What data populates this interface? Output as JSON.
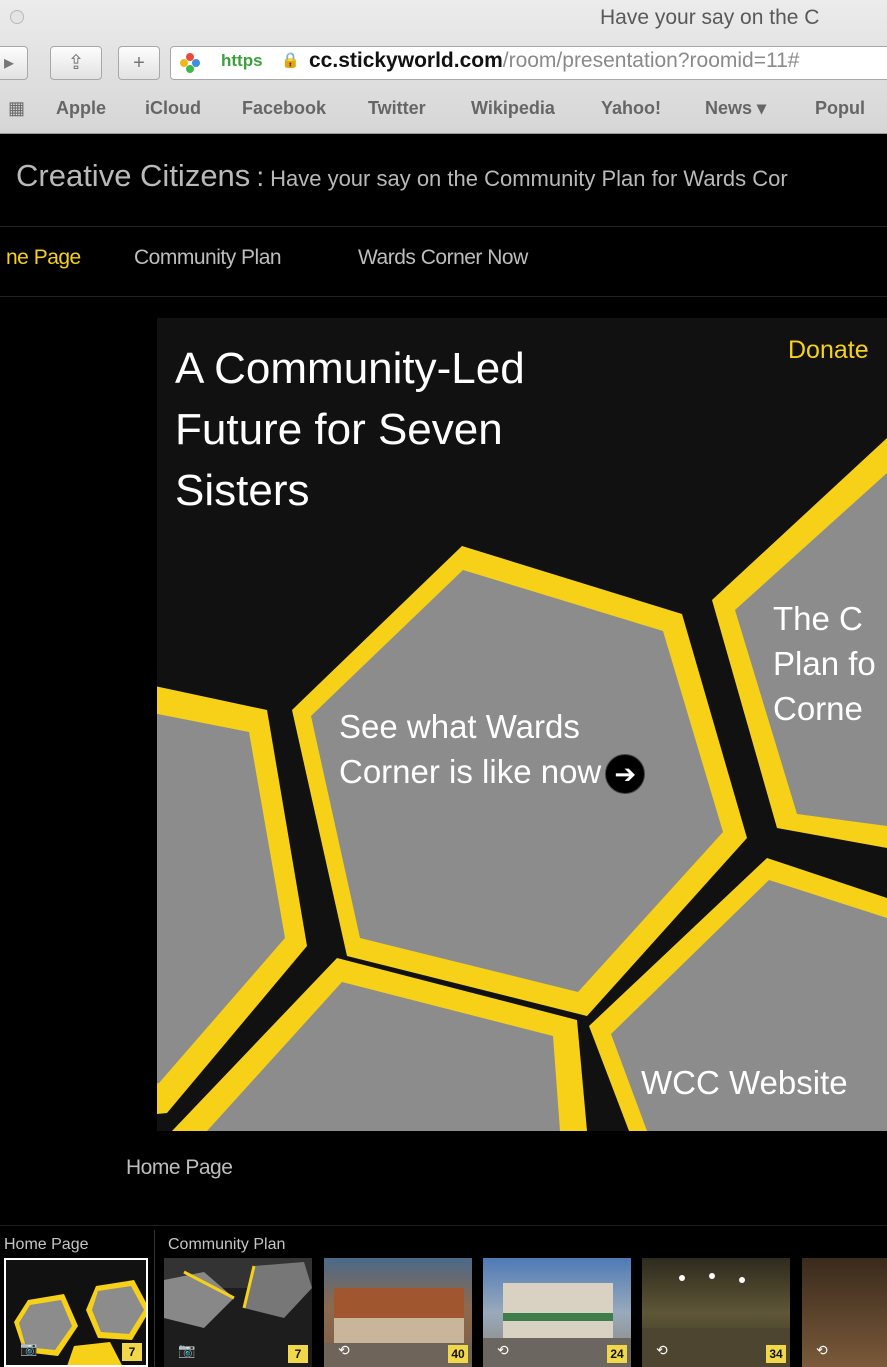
{
  "browser": {
    "window_title": "Have your say on the C",
    "url_scheme": "https",
    "url_host": "cc.stickyworld.com",
    "url_path": "/room/presentation?roomid=11#",
    "bookmarks": [
      "Apple",
      "iCloud",
      "Facebook",
      "Twitter",
      "Wikipedia",
      "Yahoo!",
      "News ▾",
      "Popul"
    ]
  },
  "site": {
    "name": "Creative Citizens",
    "separator": ":",
    "subtitle": "Have your say on the Community Plan for Wards Cor"
  },
  "nav": {
    "items": [
      "ne Page",
      "Community Plan",
      "Wards Corner Now"
    ],
    "active_index": 0
  },
  "slide": {
    "headline_lines": [
      "A Community-Led",
      "Future for Seven",
      "Sisters"
    ],
    "donate": "Donate",
    "hex_wards_lines": [
      "See what Wards",
      "Corner is like now"
    ],
    "hex_plan_lines": [
      "The C",
      "Plan fo",
      "Corne"
    ],
    "hex_wcc": "WCC Website",
    "accent_color": "#f7d117",
    "hex_fill": "#8c8c8c"
  },
  "caption": "Home Page",
  "filmstrip": {
    "groups": [
      "Home Page",
      "Community Plan"
    ],
    "thumbs": [
      {
        "icon": "camera",
        "badge": "7"
      },
      {
        "icon": "camera",
        "badge": "7"
      },
      {
        "icon": "360",
        "badge": "40"
      },
      {
        "icon": "360",
        "badge": "24"
      },
      {
        "icon": "360",
        "badge": "34"
      },
      {
        "icon": "360",
        "badge": ""
      }
    ]
  }
}
